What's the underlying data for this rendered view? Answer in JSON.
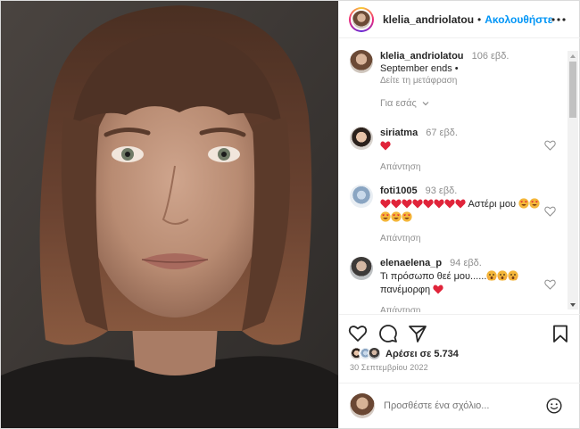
{
  "header": {
    "username": "klelia_andriolatou",
    "separator": "•",
    "follow_label": "Ακολουθήστε"
  },
  "caption": {
    "username": "klelia_andriolatou",
    "time": "106 εβδ.",
    "text": "September ends •",
    "translate_label": "Δείτε τη μετάφραση"
  },
  "filter": {
    "label": "Για εσάς"
  },
  "comments": [
    {
      "username": "siriatma",
      "time": "67 εβδ.",
      "text_before": "",
      "text_after": "",
      "reply_label": "Απάντηση"
    },
    {
      "username": "foti1005",
      "time": "93 εβδ.",
      "text_before": "",
      "text_mid": "Αστέρι μου",
      "reply_label": "Απάντηση"
    },
    {
      "username": "elenaelena_p",
      "time": "94 εβδ.",
      "text_line1": "Τι πρόσωπο θεέ μου......",
      "text_line2": "πανέμορφη",
      "reply_label": "Απάντηση"
    }
  ],
  "likes": {
    "text": "Αρέσει σε 5.734"
  },
  "date": {
    "text": "30 Σεπτεμβρίου 2022"
  },
  "add_comment": {
    "placeholder": "Προσθέστε ένα σχόλιο..."
  },
  "icons": {
    "more": "more-horizontal-icon",
    "like": "heart-outline-icon",
    "comment": "comment-bubble-icon",
    "share": "paper-plane-icon",
    "save": "bookmark-icon",
    "emoji": "smiley-face-icon"
  },
  "colors": {
    "follow": "#0095f6",
    "heart": "#ed4956",
    "muted": "#8e8e8e",
    "text": "#262626"
  }
}
